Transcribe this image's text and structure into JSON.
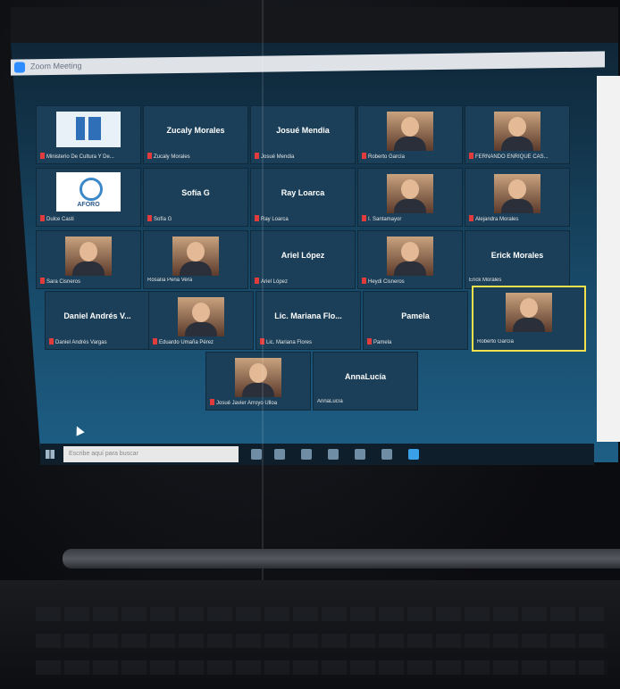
{
  "window": {
    "title": "Zoom Meeting"
  },
  "taskbar": {
    "search_placeholder": "Escribe aquí para buscar"
  },
  "tiles": [
    {
      "id": "ministerio",
      "display": "logo-ministerio",
      "label": "Ministerio De Cultura Y De..."
    },
    {
      "id": "zucaly",
      "display": "name",
      "name": "Zucaly Morales",
      "label": "Zucaly Morales"
    },
    {
      "id": "josue",
      "display": "name",
      "name": "Josué Mendia",
      "label": "Josué Mendia"
    },
    {
      "id": "roberto1",
      "display": "photo",
      "label": "Roberto García"
    },
    {
      "id": "fernando",
      "display": "photo",
      "label": "FERNANDO ENRIQUE CAS..."
    },
    {
      "id": "dulce",
      "display": "logo-aforo",
      "label": "Dulce Casti",
      "logo_text": "AFORO"
    },
    {
      "id": "sofia",
      "display": "name",
      "name": "Sofía G",
      "label": "Sofía G"
    },
    {
      "id": "ray",
      "display": "name",
      "name": "Ray Loarca",
      "label": "Ray Loarca"
    },
    {
      "id": "santamayor",
      "display": "photo",
      "label": "I. Santamayor"
    },
    {
      "id": "alejandra",
      "display": "photo",
      "label": "Alejandra Morales"
    },
    {
      "id": "sara",
      "display": "photo",
      "label": "Sara Cisneros"
    },
    {
      "id": "rosalia",
      "display": "photo",
      "label": "Rosalía Peña Vera"
    },
    {
      "id": "ariel",
      "display": "name",
      "name": "Ariel López",
      "label": "Ariel López"
    },
    {
      "id": "heydi",
      "display": "photo",
      "label": "Heydi Cisneros"
    },
    {
      "id": "erick",
      "display": "name",
      "name": "Erick Morales",
      "label": "Erick Morales"
    },
    {
      "id": "daniel",
      "display": "name",
      "name": "Daniel Andrés V...",
      "label": "Daniel Andrés Vargas"
    },
    {
      "id": "eduardo",
      "display": "photo",
      "label": "Eduardo Umaña Pérez"
    },
    {
      "id": "mariana",
      "display": "name",
      "name": "Lic. Mariana Flo...",
      "label": "Lic. Mariana Flores"
    },
    {
      "id": "pamela",
      "display": "name",
      "name": "Pamela",
      "label": "Pamela"
    },
    {
      "id": "roberto2",
      "display": "photo",
      "label": "Roberto García",
      "active": true
    },
    {
      "id": "josejavier",
      "display": "photo",
      "label": "Josué Javier Arroyo Ulloa"
    },
    {
      "id": "annalucia",
      "display": "name",
      "name": "AnnaLucía",
      "label": "AnnaLucía"
    }
  ]
}
